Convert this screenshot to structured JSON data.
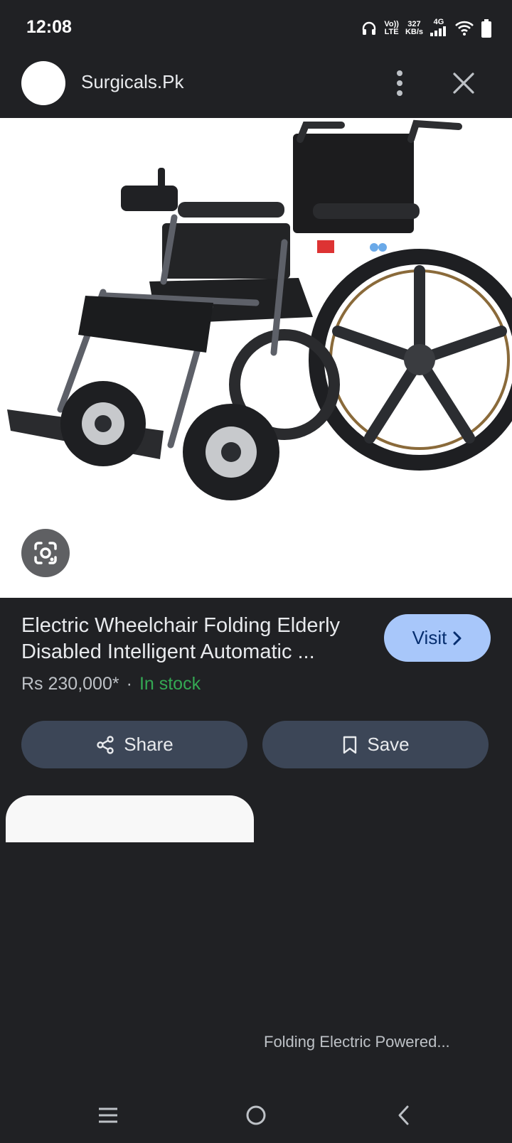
{
  "status_bar": {
    "time": "12:08",
    "volte_top": "Vo))",
    "volte_bottom": "LTE",
    "speed_top": "327",
    "speed_bottom": "KB/s",
    "network": "4G"
  },
  "header": {
    "site_name": "Surgicals.Pk"
  },
  "product": {
    "title_line1": "Electric Wheelchair Folding Elderly",
    "title_line2": "Disabled Intelligent Automatic ...",
    "price": "Rs 230,000*",
    "separator": "·",
    "stock": "In stock",
    "visit_label": "Visit"
  },
  "actions": {
    "share_label": "Share",
    "save_label": "Save"
  },
  "related": {
    "right_caption": "Folding Electric Powered..."
  },
  "colors": {
    "background": "#202124",
    "visit_button": "#a8c7fa",
    "action_button": "#3c4657",
    "in_stock": "#34a853"
  }
}
